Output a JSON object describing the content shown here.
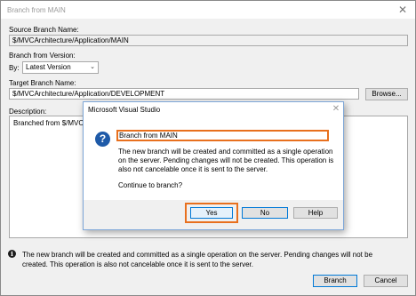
{
  "window": {
    "title": "Branch from MAIN"
  },
  "source": {
    "label": "Source Branch Name:",
    "value": "$/MVCArchitecture/Application/MAIN"
  },
  "version": {
    "label": "Branch from Version:",
    "by_label": "By:",
    "selected": "Latest Version"
  },
  "target": {
    "label": "Target Branch Name:",
    "value": "$/MVCArchitecture/Application/DEVELOPMENT",
    "browse_label": "Browse..."
  },
  "description": {
    "label": "Description:",
    "value": "Branched from $/MVCA"
  },
  "info": {
    "text": "The new branch will be created and committed as a single operation on the server. Pending changes will not be created. This operation is also not cancelable once it is sent to the server."
  },
  "footer": {
    "branch_label": "Branch",
    "cancel_label": "Cancel"
  },
  "dialog": {
    "title": "Microsoft Visual Studio",
    "heading": "Branch from MAIN",
    "body": "The new branch will be created and committed as a single operation on the server. Pending changes will not be created. This operation is also not cancelable once it is sent to the server.",
    "question": "Continue to branch?",
    "yes_label": "Yes",
    "no_label": "No",
    "help_label": "Help",
    "icon": "question-icon"
  },
  "colors": {
    "highlight": "#e8701e",
    "accent": "#0078d7",
    "icon_blue": "#1e5aa8"
  }
}
